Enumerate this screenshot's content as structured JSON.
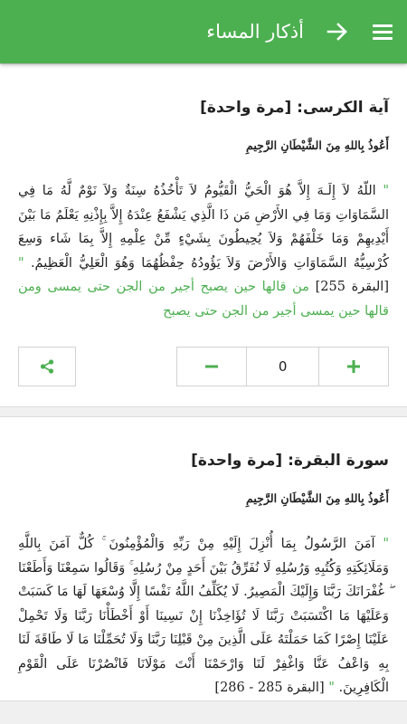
{
  "appbar": {
    "title": "أذكار المساء",
    "menu_icon": "hamburger-menu-icon",
    "back_icon": "arrow-right-icon",
    "color": "#4caf50"
  },
  "cards": [
    {
      "title": "آية الكرسى: [مرة واحدة]",
      "istiadha": "أَعُوذُ بِاللهِ مِنَ الشَّيْطَانِ الرَّجِيمِ",
      "quote_open": "\"",
      "text": "اللّهُ لاَ إِلَـهَ إِلاَّ هُوَ الْحَيُّ الْقَيُّومُ لاَ تَأْخُذُهُ سِنَةٌ وَلاَ نَوْمٌ لَّهُ مَا فِي السَّمَاوَاتِ وَمَا فِي الأَرْضِ مَن ذَا الَّذِي يَشْفَعُ عِنْدَهُ إِلاَّ بِإِذْنِهِ يَعْلَمُ مَا بَيْنَ أَيْدِيهِمْ وَمَا خَلْفَهُمْ وَلاَ يُحِيطُونَ بِشَيْءٍ مِّنْ عِلْمِهِ إِلاَّ بِمَا شَاء وَسِعَ كُرْسِيُّهُ السَّمَاوَاتِ وَالأَرْضَ وَلاَ يَؤُودُهُ حِفْظُهُمَا وَهُوَ الْعَلِيُّ الْعَظِيمُ.",
      "quote_close": "\"",
      "reference": "[البقرة 255]",
      "virtue": "من قالها حين يصبح أجير من الجن حتى يمسى ومن قالها حين يمسى أجير من الجن حتى يصبح",
      "count": "0",
      "plus_icon": "plus-icon",
      "minus_icon": "minus-icon",
      "share_icon": "share-icon"
    },
    {
      "title": "سورة البقرة: [مرة واحدة]",
      "istiadha": "أَعُوذُ بِاللهِ مِنَ الشَّيْطَانِ الرَّجِيمِ",
      "quote_open": "\"",
      "text": "آمَنَ الرَّسُولُ بِمَا أُنْزِلَ إِلَيْهِ مِنْ رَبِّهِ وَالْمُؤْمِنُونَ ۚ كُلٌّ آمَنَ بِاللَّهِ وَمَلَائِكَتِهِ وَكُتُبِهِ وَرُسُلِهِ لَا نُفَرِّقُ بَيْنَ أَحَدٍ مِنْ رُسُلِهِ ۚ وَقَالُوا سَمِعْنَا وَأَطَعْنَا ۖ غُفْرَانَكَ رَبَّنَا وَإِلَيْكَ الْمَصِيرُ. لَا يُكَلِّفُ اللَّهُ نَفْسًا إِلَّا وُسْعَهَا لَهَا مَا كَسَبَتْ وَعَلَيْهَا مَا اكْتَسَبَتْ رَبَّنَا لَا تُؤَاخِذْنَا إِنْ نَسِينَا أَوْ أَخْطَأْنَا رَبَّنَا وَلَا تَحْمِلْ عَلَيْنَا إِصْرًا كَمَا حَمَلْتَهُ عَلَى الَّذِينَ مِنْ قَبْلِنَا رَبَّنَا وَلَا تُحَمِّلْنَا مَا لَا طَاقَةَ لَنَا بِهِ وَاعْفُ عَنَّا وَاغْفِرْ لَنَا وَارْحَمْنَا أَنْتَ مَوْلَانَا فَانْصُرْنَا عَلَى الْقَوْمِ الْكَافِرِينَ.",
      "quote_close": "\"",
      "reference": "[البقرة 285 - 286]"
    }
  ]
}
